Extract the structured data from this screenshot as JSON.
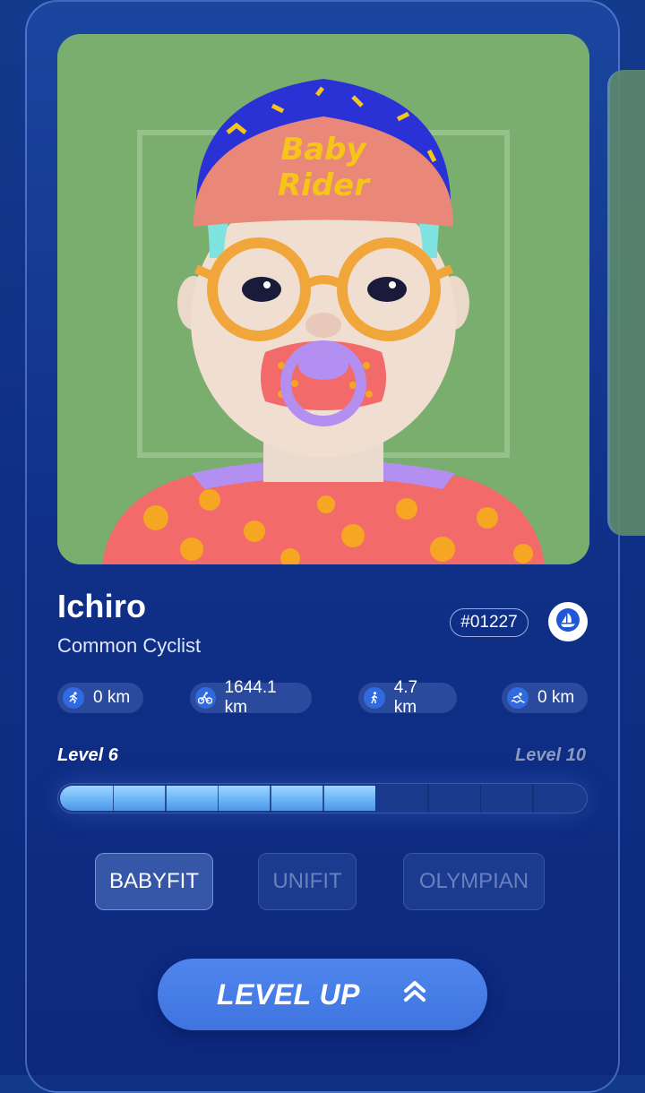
{
  "profile": {
    "name": "Ichiro",
    "subtitle": "Common Cyclist",
    "token_id": "#01227",
    "cap_text_line1": "Baby",
    "cap_text_line2": "Rider"
  },
  "stats": [
    {
      "icon": "run-icon",
      "value": "0 km"
    },
    {
      "icon": "bike-icon",
      "value": "1644.1 km"
    },
    {
      "icon": "walk-icon",
      "value": "4.7 km"
    },
    {
      "icon": "swim-icon",
      "value": "0 km"
    }
  ],
  "level": {
    "current_label": "Level 6",
    "max_label": "Level 10",
    "current": 6,
    "max": 10
  },
  "tiers": [
    {
      "label": "BABYFIT",
      "active": true
    },
    {
      "label": "UNIFIT",
      "active": false
    },
    {
      "label": "OLYMPIAN",
      "active": false
    }
  ],
  "action": {
    "label": "LEVEL UP"
  },
  "colors": {
    "accent": "#3f74e0",
    "progress": "#6cb4f6",
    "avatar_bg": "#7aae6e"
  }
}
